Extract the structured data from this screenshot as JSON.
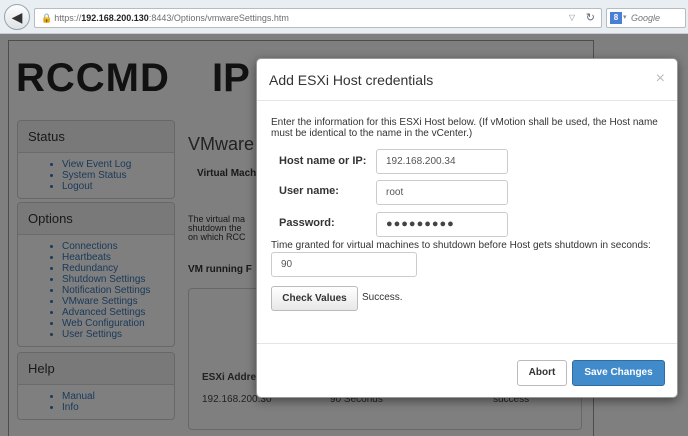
{
  "browser": {
    "url_prefix": "https://",
    "url_host": "192.168.200.130",
    "url_rest": ":8443/Options/vmwareSettings.htm",
    "search_placeholder": "Google",
    "search_engine_letter": "8"
  },
  "page": {
    "logo_text": "RCCMD",
    "logo_text_2": "IP",
    "status": {
      "heading": "Status",
      "items": [
        "View Event Log",
        "System Status",
        "Logout"
      ]
    },
    "options": {
      "heading": "Options",
      "items": [
        "Connections",
        "Heartbeats",
        "Redundancy",
        "Shutdown Settings",
        "Notification Settings",
        "VMware Settings",
        "Advanced Settings",
        "Web Configuration",
        "User Settings"
      ]
    },
    "help": {
      "heading": "Help",
      "items": [
        "Manual",
        "Info"
      ]
    },
    "content_title": "VMware",
    "virtual_machines_label": "Virtual Mach",
    "description_lines": [
      "The virtual ma",
      "shutdown the",
      "on which RCC"
    ],
    "vm_running_label": "VM running F",
    "table_header": "ESXi Addre",
    "row_address": "192.168.200.30",
    "row_time": "90 Seconds",
    "row_status": "success"
  },
  "modal": {
    "title": "Add ESXi Host credentials",
    "close_glyph": "×",
    "intro": "Enter the information for this ESXi Host below. (If vMotion shall be used, the Host name must be identical to the name in the vCenter.)",
    "host_label": "Host name or IP:",
    "host_value": "192.168.200.34",
    "user_label": "User name:",
    "user_value": "root",
    "password_label": "Password:",
    "password_value": "●●●●●●●●●",
    "time_label": "Time granted for virtual machines to shutdown before Host gets shutdown in seconds:",
    "time_value": "90",
    "check_button": "Check Values",
    "check_status": "Success.",
    "abort_button": "Abort",
    "save_button": "Save Changes"
  },
  "colors": {
    "primary": "#428bca",
    "link": "#3575b5"
  }
}
